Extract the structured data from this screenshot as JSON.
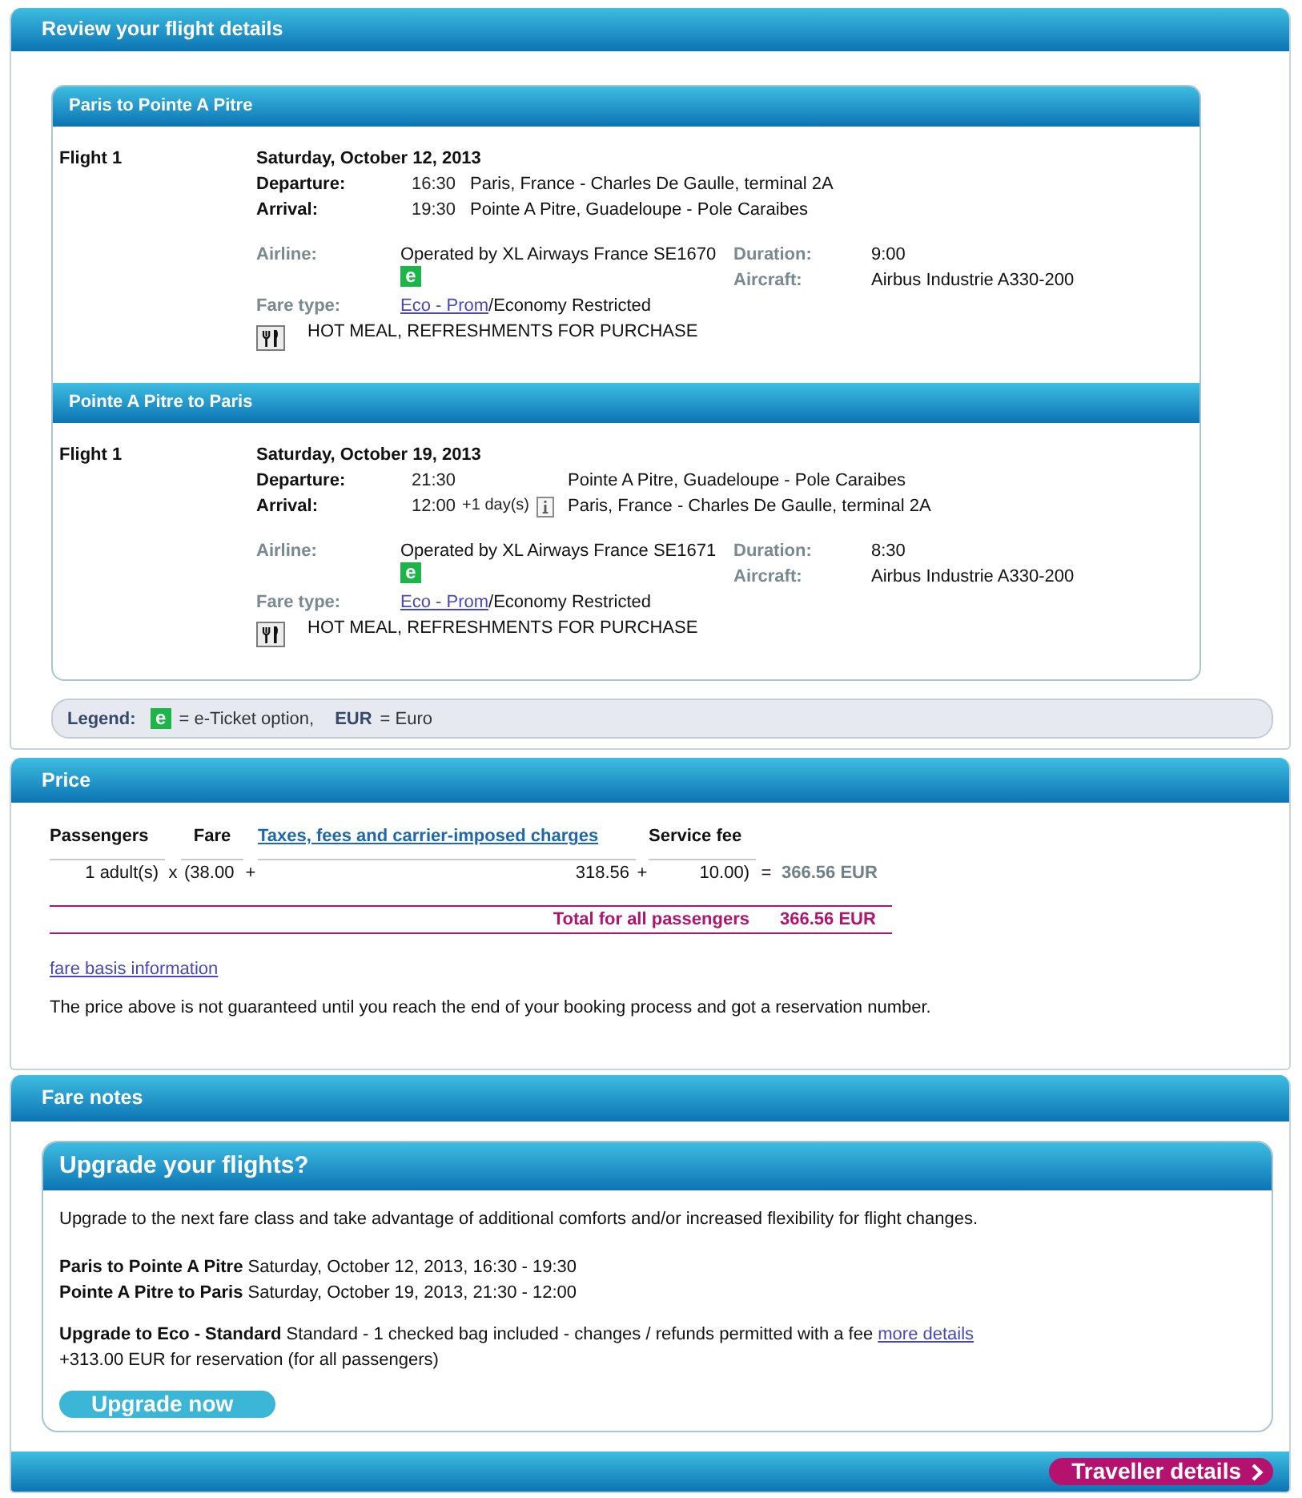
{
  "review": {
    "title": "Review your flight details",
    "journeys": [
      {
        "title": "Paris to Pointe A Pitre",
        "flights": [
          {
            "label": "Flight 1",
            "date": "Saturday, October 12, 2013",
            "times": [
              {
                "label": "Departure:",
                "time": "16:30",
                "place": "Paris, France - Charles De Gaulle, terminal 2A"
              },
              {
                "label": "Arrival:",
                "time": "19:30",
                "place": "Pointe A Pitre, Guadeloupe - Pole Caraibes"
              }
            ],
            "airline": {
              "label": "Airline:",
              "value": "Operated by XL Airways France SE1670",
              "eticket": "e"
            },
            "duration": {
              "label": "Duration:",
              "value": "9:00"
            },
            "aircraft": {
              "label": "Aircraft:",
              "value": "Airbus Industrie A330-200"
            },
            "fare_type": {
              "label": "Fare type:",
              "link": "Eco - Prom",
              "value": "/Economy Restricted"
            },
            "meal": "HOT MEAL, REFRESHMENTS FOR PURCHASE"
          }
        ]
      },
      {
        "title": "Pointe A Pitre to Paris",
        "flights": [
          {
            "label": "Flight 1",
            "date": "Saturday, October 19, 2013",
            "times": [
              {
                "label": "Departure:",
                "time": "21:30",
                "place": "Pointe A Pitre, Guadeloupe - Pole Caraibes"
              },
              {
                "label": "Arrival:",
                "time": "12:00",
                "day_offset": "+1 day(s)",
                "info": true,
                "place": "Paris, France - Charles De Gaulle, terminal 2A"
              }
            ],
            "airline": {
              "label": "Airline:",
              "value": "Operated by XL Airways France SE1671",
              "eticket": "e"
            },
            "duration": {
              "label": "Duration:",
              "value": "8:30"
            },
            "aircraft": {
              "label": "Aircraft:",
              "value": "Airbus Industrie A330-200"
            },
            "fare_type": {
              "label": "Fare type:",
              "link": "Eco - Prom",
              "value": "/Economy Restricted"
            },
            "meal": "HOT MEAL, REFRESHMENTS FOR PURCHASE"
          }
        ]
      }
    ],
    "legend": {
      "label": "Legend:",
      "items": [
        {
          "kind": "badge",
          "symbol": "e",
          "text": "= e-Ticket option,"
        },
        {
          "kind": "code",
          "symbol": "EUR",
          "text": "= Euro"
        }
      ]
    }
  },
  "price": {
    "title": "Price",
    "columns": [
      {
        "label": "Passengers",
        "kind": "text"
      },
      {
        "label": "Fare",
        "kind": "text"
      },
      {
        "label": "Taxes, fees and carrier-imposed charges",
        "kind": "link"
      },
      {
        "label": "Service fee",
        "kind": "text"
      }
    ],
    "cells": [
      {
        "kind": "count",
        "text": "1 adult(s)"
      },
      {
        "kind": "operator",
        "text": "x"
      },
      {
        "kind": "amount",
        "text": "(38.00"
      },
      {
        "kind": "operator",
        "text": "+"
      },
      {
        "kind": "amount",
        "text": "318.56"
      },
      {
        "kind": "operator",
        "text": "+"
      },
      {
        "kind": "amount",
        "text": "10.00)"
      },
      {
        "kind": "operator",
        "text": "="
      },
      {
        "kind": "result",
        "text": "366.56 EUR"
      }
    ],
    "total": {
      "label": "Total for all passengers",
      "amount": "366.56 EUR"
    },
    "link": "fare basis information",
    "note": "The price above is not guaranteed until you reach the end of your booking process and got a reservation number."
  },
  "fare_notes": {
    "title": "Fare notes",
    "upgrade": {
      "title": "Upgrade your flights?",
      "intro": "Upgrade to the next fare class and take advantage of additional comforts and/or increased flexibility for flight changes.",
      "routes": [
        "**Paris to Pointe A Pitre** Saturday, October 12, 2013, 16:30 - 19:30",
        "**Pointe A Pitre to Paris** Saturday, October 19, 2013, 21:30 - 12:00"
      ],
      "offer": {
        "text": "**Upgrade to Eco - Standard** Standard - 1 checked bag included - changes / refunds permitted with a fee",
        "link": "more details",
        "price": "+313.00 EUR for reservation (for all passengers)"
      },
      "button": "Upgrade now"
    }
  },
  "footer": {
    "button": "Traveller details"
  }
}
